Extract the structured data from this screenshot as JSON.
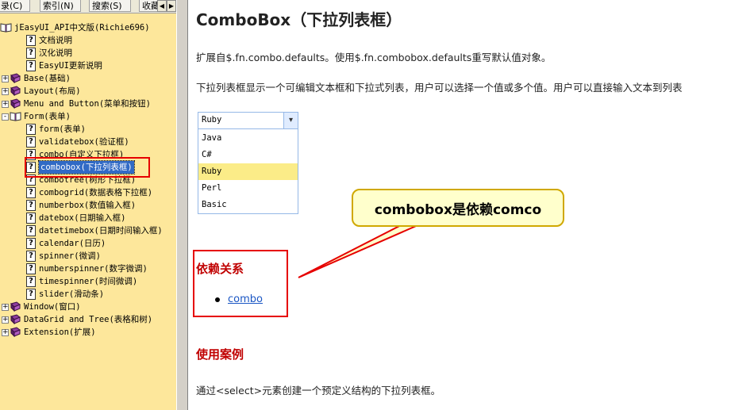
{
  "sidebar": {
    "tabs": [
      "目录(C)",
      "索引(N)",
      "搜索(S)",
      "收藏"
    ],
    "tab_arrows": [
      "◀",
      "▶"
    ],
    "tree": [
      {
        "label": "jEasyUI_API中文版(Richie696)",
        "icon": "book-open-icon",
        "level": 0,
        "expander": ""
      },
      {
        "label": "文档说明",
        "icon": "help-page-icon",
        "level": 1,
        "expander": ""
      },
      {
        "label": "汉化说明",
        "icon": "help-page-icon",
        "level": 1,
        "expander": ""
      },
      {
        "label": "EasyUI更新说明",
        "icon": "help-page-icon",
        "level": 1,
        "expander": ""
      },
      {
        "label": "Base(基础)",
        "icon": "book-icon",
        "level": 0,
        "expander": "+"
      },
      {
        "label": "Layout(布局)",
        "icon": "book-icon",
        "level": 0,
        "expander": "+"
      },
      {
        "label": "Menu and Button(菜单和按钮)",
        "icon": "book-icon",
        "level": 0,
        "expander": "+"
      },
      {
        "label": "Form(表单)",
        "icon": "book-open-icon",
        "level": 0,
        "expander": "-"
      },
      {
        "label": "form(表单)",
        "icon": "help-page-icon",
        "level": 1,
        "expander": ""
      },
      {
        "label": "validatebox(验证框)",
        "icon": "help-page-icon",
        "level": 1,
        "expander": ""
      },
      {
        "label": "combo(自定义下拉框)",
        "icon": "help-page-icon",
        "level": 1,
        "expander": ""
      },
      {
        "label": "combobox(下拉列表框)",
        "icon": "help-page-icon",
        "level": 1,
        "expander": "",
        "selected": true
      },
      {
        "label": "combotree(树形下拉框)",
        "icon": "help-page-icon",
        "level": 1,
        "expander": ""
      },
      {
        "label": "combogrid(数据表格下拉框)",
        "icon": "help-page-icon",
        "level": 1,
        "expander": ""
      },
      {
        "label": "numberbox(数值输入框)",
        "icon": "help-page-icon",
        "level": 1,
        "expander": ""
      },
      {
        "label": "datebox(日期输入框)",
        "icon": "help-page-icon",
        "level": 1,
        "expander": ""
      },
      {
        "label": "datetimebox(日期时间输入框)",
        "icon": "help-page-icon",
        "level": 1,
        "expander": ""
      },
      {
        "label": "calendar(日历)",
        "icon": "help-page-icon",
        "level": 1,
        "expander": ""
      },
      {
        "label": "spinner(微调)",
        "icon": "help-page-icon",
        "level": 1,
        "expander": ""
      },
      {
        "label": "numberspinner(数字微调)",
        "icon": "help-page-icon",
        "level": 1,
        "expander": ""
      },
      {
        "label": "timespinner(时间微调)",
        "icon": "help-page-icon",
        "level": 1,
        "expander": ""
      },
      {
        "label": "slider(滑动条)",
        "icon": "help-page-icon",
        "level": 1,
        "expander": ""
      },
      {
        "label": "Window(窗口)",
        "icon": "book-icon",
        "level": 0,
        "expander": "+"
      },
      {
        "label": "DataGrid and Tree(表格和树)",
        "icon": "book-icon",
        "level": 0,
        "expander": "+"
      },
      {
        "label": "Extension(扩展)",
        "icon": "book-icon",
        "level": 0,
        "expander": "+"
      }
    ]
  },
  "content": {
    "title": "ComboBox（下拉列表框）",
    "intro": "扩展自$.fn.combo.defaults。使用$.fn.combobox.defaults重写默认值对象。",
    "description": "下拉列表框显示一个可编辑文本框和下拉式列表，用户可以选择一个值或多个值。用户可以直接输入文本到列表",
    "demo": {
      "value": "Ruby",
      "arrow": "▾",
      "options": [
        "Java",
        "C#",
        "Ruby",
        "Perl",
        "Basic"
      ],
      "selected_option": "Ruby"
    },
    "callout": "combobox是依赖comco",
    "dependencies_heading": "依赖关系",
    "dependencies": [
      "combo"
    ],
    "usage_heading": "使用案例",
    "usage_text": "通过<select>元素创建一个预定义结构的下拉列表框。"
  },
  "colors": {
    "sidebar_bg": "#fde79b",
    "highlight_red": "#e60000",
    "heading_red": "#c00000",
    "link_blue": "#1a56c4",
    "combo_selected": "#fbec88"
  }
}
